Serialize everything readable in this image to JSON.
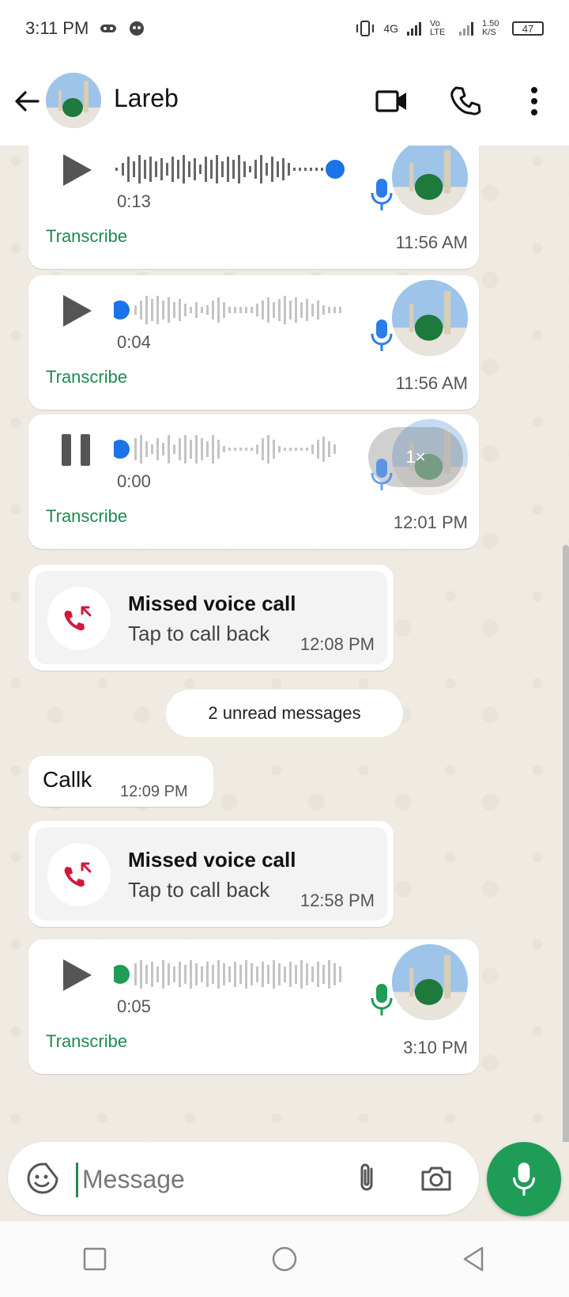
{
  "status_bar": {
    "time": "3:11 PM",
    "network": "4G",
    "volte": "Vo LTE",
    "speed": "1.50 K/S",
    "battery": "47"
  },
  "header": {
    "contact_name": "Lareb"
  },
  "voice_notes": [
    {
      "duration": "0:13",
      "transcribe": "Transcribe",
      "time": "11:56 AM",
      "state": "play",
      "progress": 1.0
    },
    {
      "duration": "0:04",
      "transcribe": "Transcribe",
      "time": "11:56 AM",
      "state": "play",
      "progress": 0.0
    },
    {
      "duration": "0:00",
      "transcribe": "Transcribe",
      "time": "12:01 PM",
      "state": "pause",
      "progress": 0.0,
      "speed": "1×"
    },
    {
      "duration": "0:05",
      "transcribe": "Transcribe",
      "time": "3:10 PM",
      "state": "play",
      "progress": 0.0
    }
  ],
  "missed_calls": [
    {
      "title": "Missed voice call",
      "subtitle": "Tap to call back",
      "time": "12:08 PM"
    },
    {
      "title": "Missed voice call",
      "subtitle": "Tap to call back",
      "time": "12:58 PM"
    }
  ],
  "unread_divider": "2 unread messages",
  "text_message": {
    "text": "Callk",
    "time": "12:09 PM"
  },
  "input": {
    "placeholder": "Message"
  },
  "colors": {
    "accent_green": "#1f9c56",
    "link_green": "#1f8a50",
    "played_blue": "#1a73e8",
    "mic_blue": "#2b7de9",
    "chat_bg": "#efeae2"
  },
  "icons": [
    "back-arrow-icon",
    "video-call-icon",
    "phone-icon",
    "more-vert-icon",
    "play-icon",
    "pause-icon",
    "mic-icon",
    "missed-call-icon",
    "sticker-icon",
    "attach-icon",
    "camera-icon",
    "square-nav-icon",
    "circle-nav-icon",
    "triangle-nav-icon"
  ]
}
